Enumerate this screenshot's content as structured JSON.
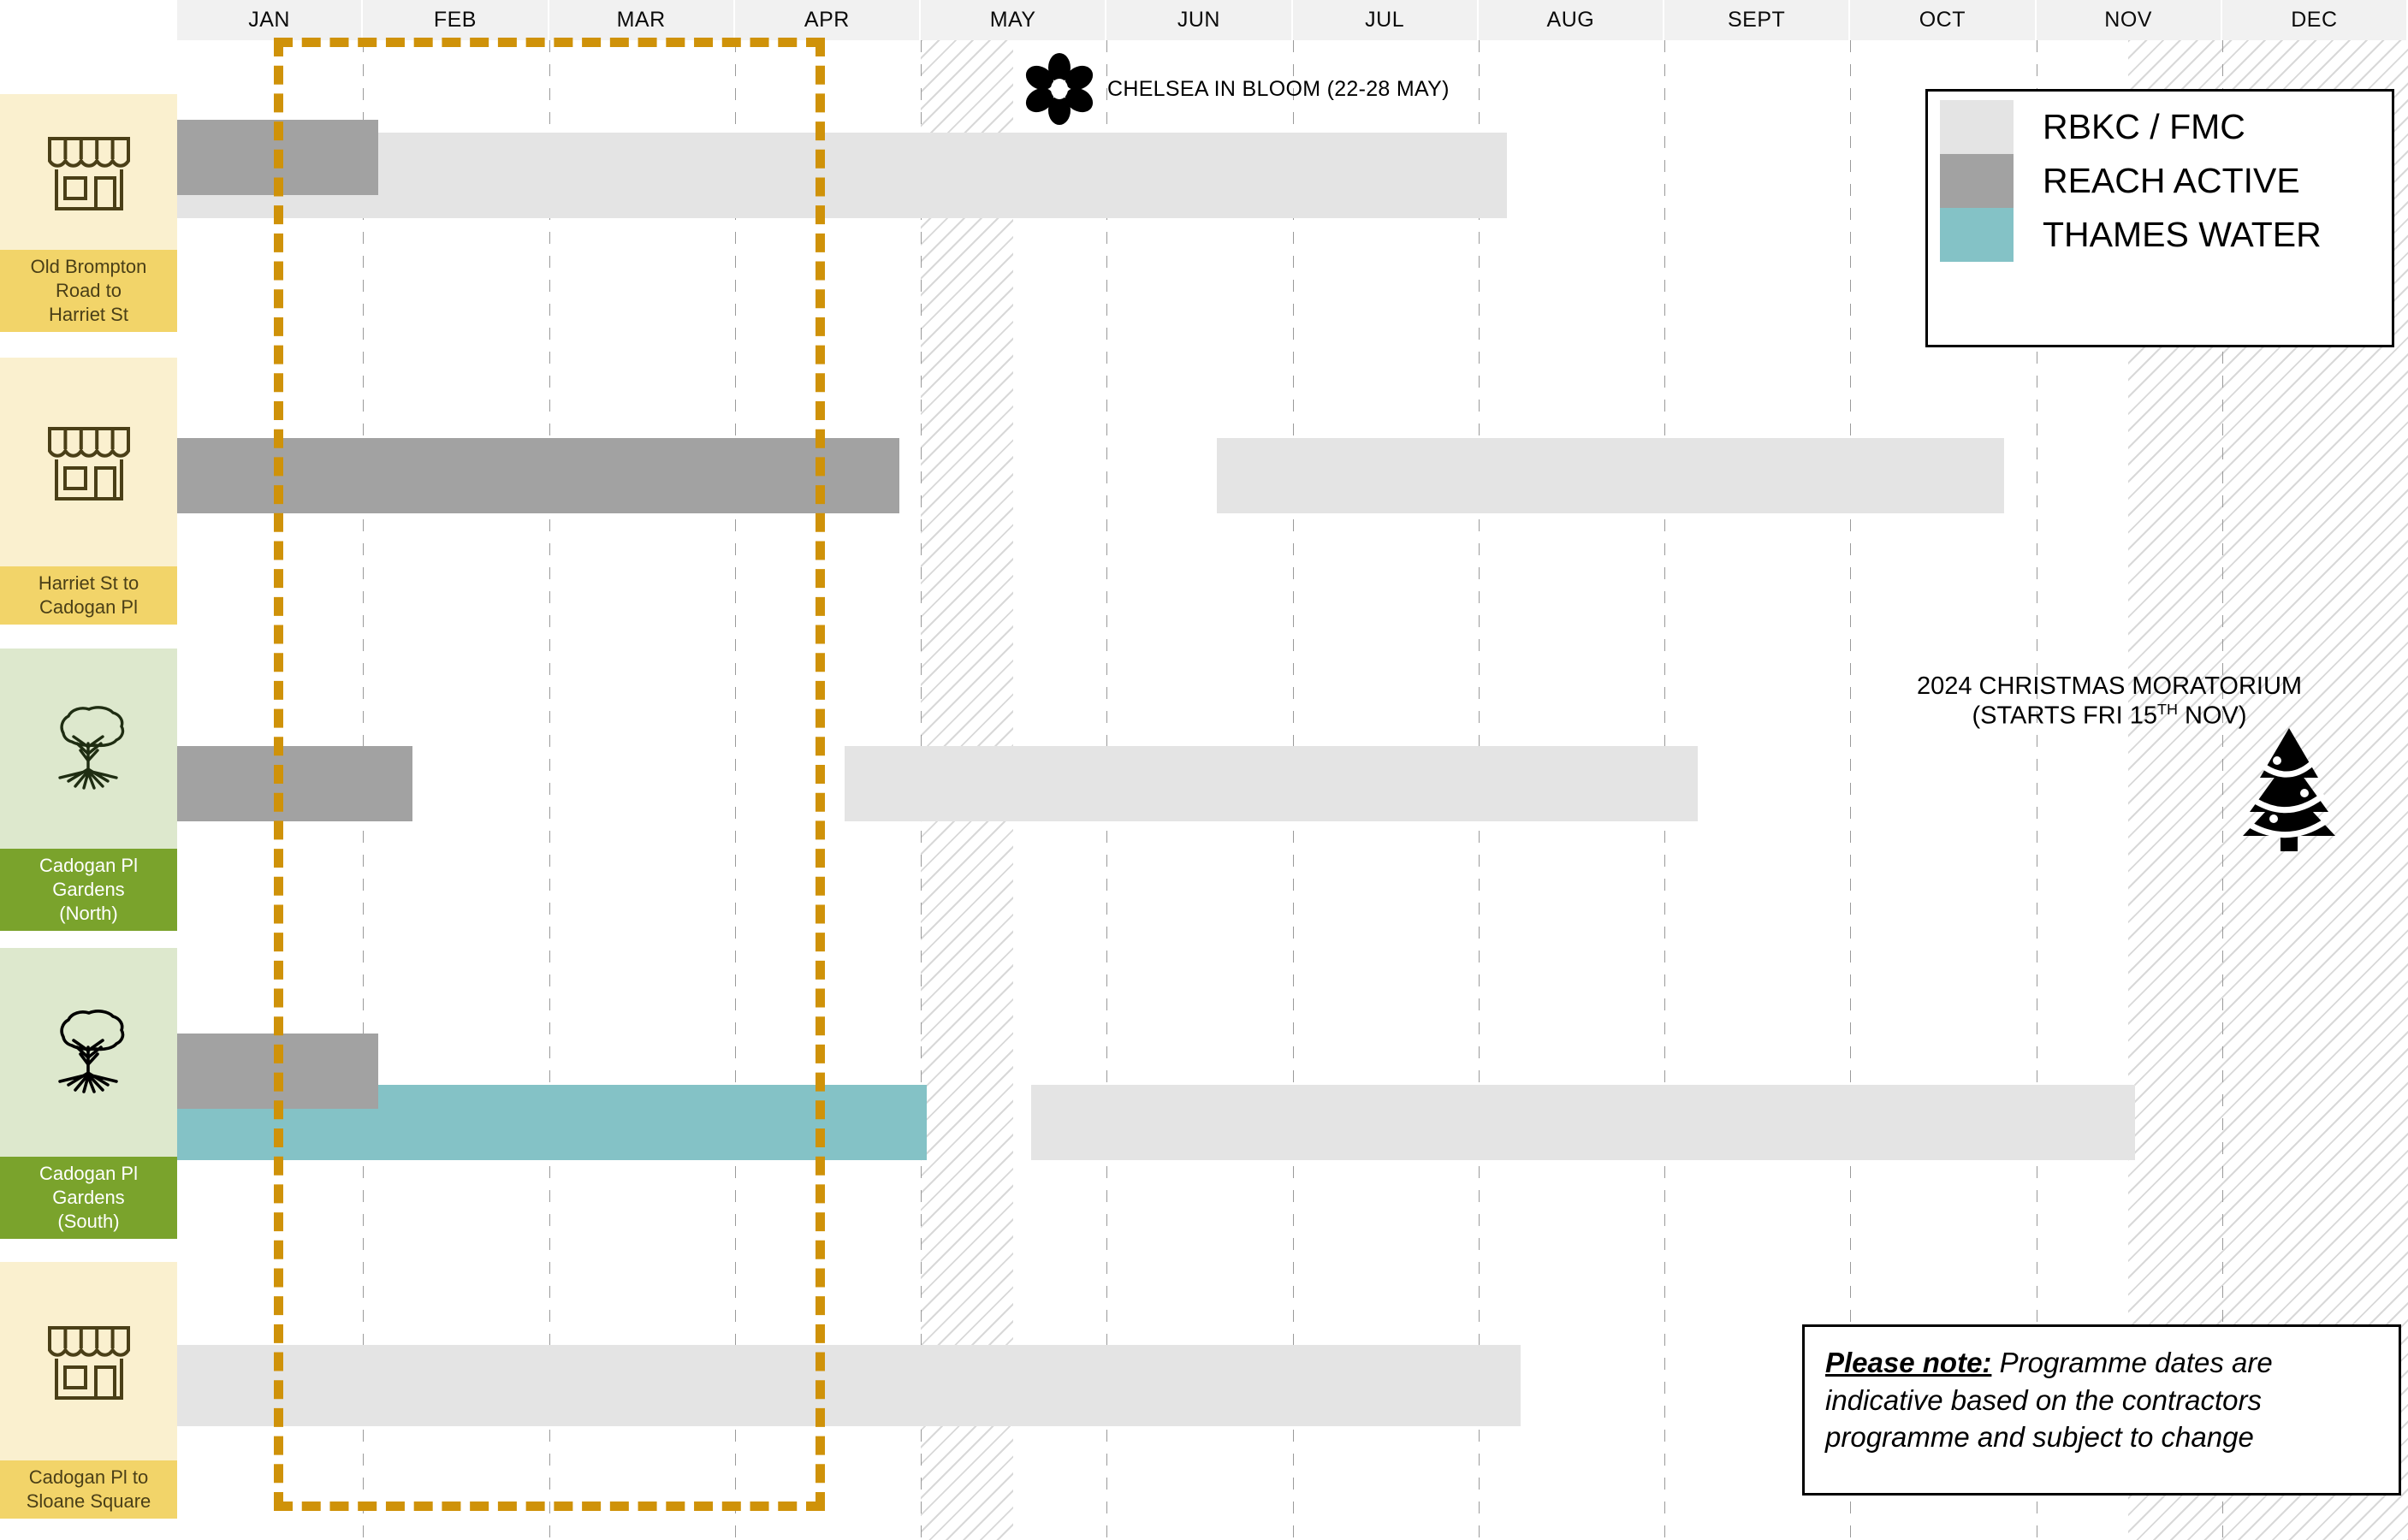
{
  "chart_data": {
    "type": "bar",
    "title": "",
    "xlabel": "",
    "ylabel": "",
    "categories": [
      "JAN",
      "FEB",
      "MAR",
      "APR",
      "MAY",
      "JUN",
      "JUL",
      "AUG",
      "SEPT",
      "OCT",
      "NOV",
      "DEC"
    ],
    "rows": [
      {
        "label": "Old Brompton Road to Harriet St",
        "icon": "shop-icon",
        "theme": "shop",
        "bars": [
          {
            "contractor": "RBKC / FMC",
            "start_month": "JAN",
            "end_month": "AUG",
            "color": "#e4e4e4"
          },
          {
            "contractor": "REACH ACTIVE",
            "start_month": "JAN",
            "end_month": "FEB",
            "color": "#a2a2a2"
          }
        ]
      },
      {
        "label": "Harriet St to Cadogan Pl",
        "icon": "shop-icon",
        "theme": "shop",
        "bars": [
          {
            "contractor": "REACH ACTIVE",
            "start_month": "JAN",
            "end_month": "APR",
            "color": "#a2a2a2"
          },
          {
            "contractor": "RBKC / FMC",
            "start_month": "JUN",
            "end_month": "NOV",
            "color": "#e4e4e4"
          }
        ]
      },
      {
        "label": "Cadogan Pl Gardens (North)",
        "icon": "tree-icon",
        "theme": "tree",
        "bars": [
          {
            "contractor": "REACH ACTIVE",
            "start_month": "JAN",
            "end_month": "FEB",
            "color": "#a2a2a2"
          },
          {
            "contractor": "RBKC / FMC",
            "start_month": "APR",
            "end_month": "SEPT",
            "color": "#e4e4e4"
          }
        ]
      },
      {
        "label": "Cadogan Pl Gardens (South)",
        "icon": "tree-icon",
        "theme": "tree",
        "bars": [
          {
            "contractor": "REACH ACTIVE",
            "start_month": "JAN",
            "end_month": "FEB",
            "color": "#a2a2a2"
          },
          {
            "contractor": "THAMES WATER",
            "start_month": "JAN",
            "end_month": "APR",
            "color": "#84c2c6"
          },
          {
            "contractor": "RBKC / FMC",
            "start_month": "MAY",
            "end_month": "OCT",
            "color": "#e4e4e4"
          }
        ]
      },
      {
        "label": "Cadogan Pl to Sloane Square",
        "icon": "shop-icon",
        "theme": "shop",
        "bars": [
          {
            "contractor": "RBKC / FMC",
            "start_month": "JAN",
            "end_month": "AUG",
            "color": "#e4e4e4"
          }
        ]
      }
    ],
    "highlight_window": {
      "start_month": "JAN",
      "end_month": "APR",
      "color": "#cf9209",
      "style": "dashed"
    },
    "hatched_periods": [
      {
        "label": "CHELSEA IN BLOOM",
        "start_month": "MAY",
        "end_month": "MAY"
      },
      {
        "label": "2024 CHRISTMAS MORATORIUM",
        "start_month": "NOV",
        "end_month": "DEC"
      }
    ],
    "legend_position": "top-right",
    "grid": true
  },
  "months": [
    "JAN",
    "FEB",
    "MAR",
    "APR",
    "MAY",
    "JUN",
    "JUL",
    "AUG",
    "SEPT",
    "OCT",
    "NOV",
    "DEC"
  ],
  "rows": [
    {
      "label_line1": "Old Brompton",
      "label_line2": "Road to",
      "label_line3": "Harriet St",
      "label": "Old Brompton Road to Harriet St"
    },
    {
      "label_line1": "Harriet St to",
      "label_line2": "Cadogan Pl",
      "label_line3": "",
      "label": "Harriet St to Cadogan Pl"
    },
    {
      "label_line1": "Cadogan Pl",
      "label_line2": "Gardens",
      "label_line3": "(North)",
      "label": "Cadogan Pl Gardens (North)"
    },
    {
      "label_line1": "Cadogan Pl",
      "label_line2": "Gardens",
      "label_line3": "(South)",
      "label": "Cadogan Pl Gardens (South)"
    },
    {
      "label_line1": "Cadogan Pl to",
      "label_line2": "Sloane Square",
      "label_line3": "",
      "label": "Cadogan Pl to Sloane Square"
    }
  ],
  "legend": {
    "items": [
      {
        "label": "RBKC / FMC",
        "color": "#e4e4e4",
        "swatch": "rbkc"
      },
      {
        "label": "REACH ACTIVE",
        "color": "#a2a2a2",
        "swatch": "reach"
      },
      {
        "label": "THAMES WATER",
        "color": "#84c2c6",
        "swatch": "tw"
      }
    ]
  },
  "annotations": {
    "chelsea_in_bloom": {
      "label": "CHELSEA IN BLOOM (22-28 MAY)",
      "icon": "flower-icon"
    },
    "christmas": {
      "line1": "2024 CHRISTMAS MORATORIUM",
      "line2_pre": "(STARTS FRI 15",
      "line2_sup": "TH",
      "line2_post": " NOV)",
      "icon": "christmas-tree-icon"
    },
    "please_note": {
      "strong": "Please note:",
      "body": " Programme dates are indicative based on the contractors programme and subject to change"
    }
  },
  "colors": {
    "accent_orange": "#cf9209",
    "shop_caption_bg": "#f2d469",
    "shop_icon_bg": "#faf0cf",
    "tree_caption_bg": "#7aa32c",
    "tree_icon_bg": "#dde8cd",
    "rbkc": "#e4e4e4",
    "reach": "#a2a2a2",
    "thames": "#84c2c6",
    "header_bg": "#f1f1f1"
  }
}
